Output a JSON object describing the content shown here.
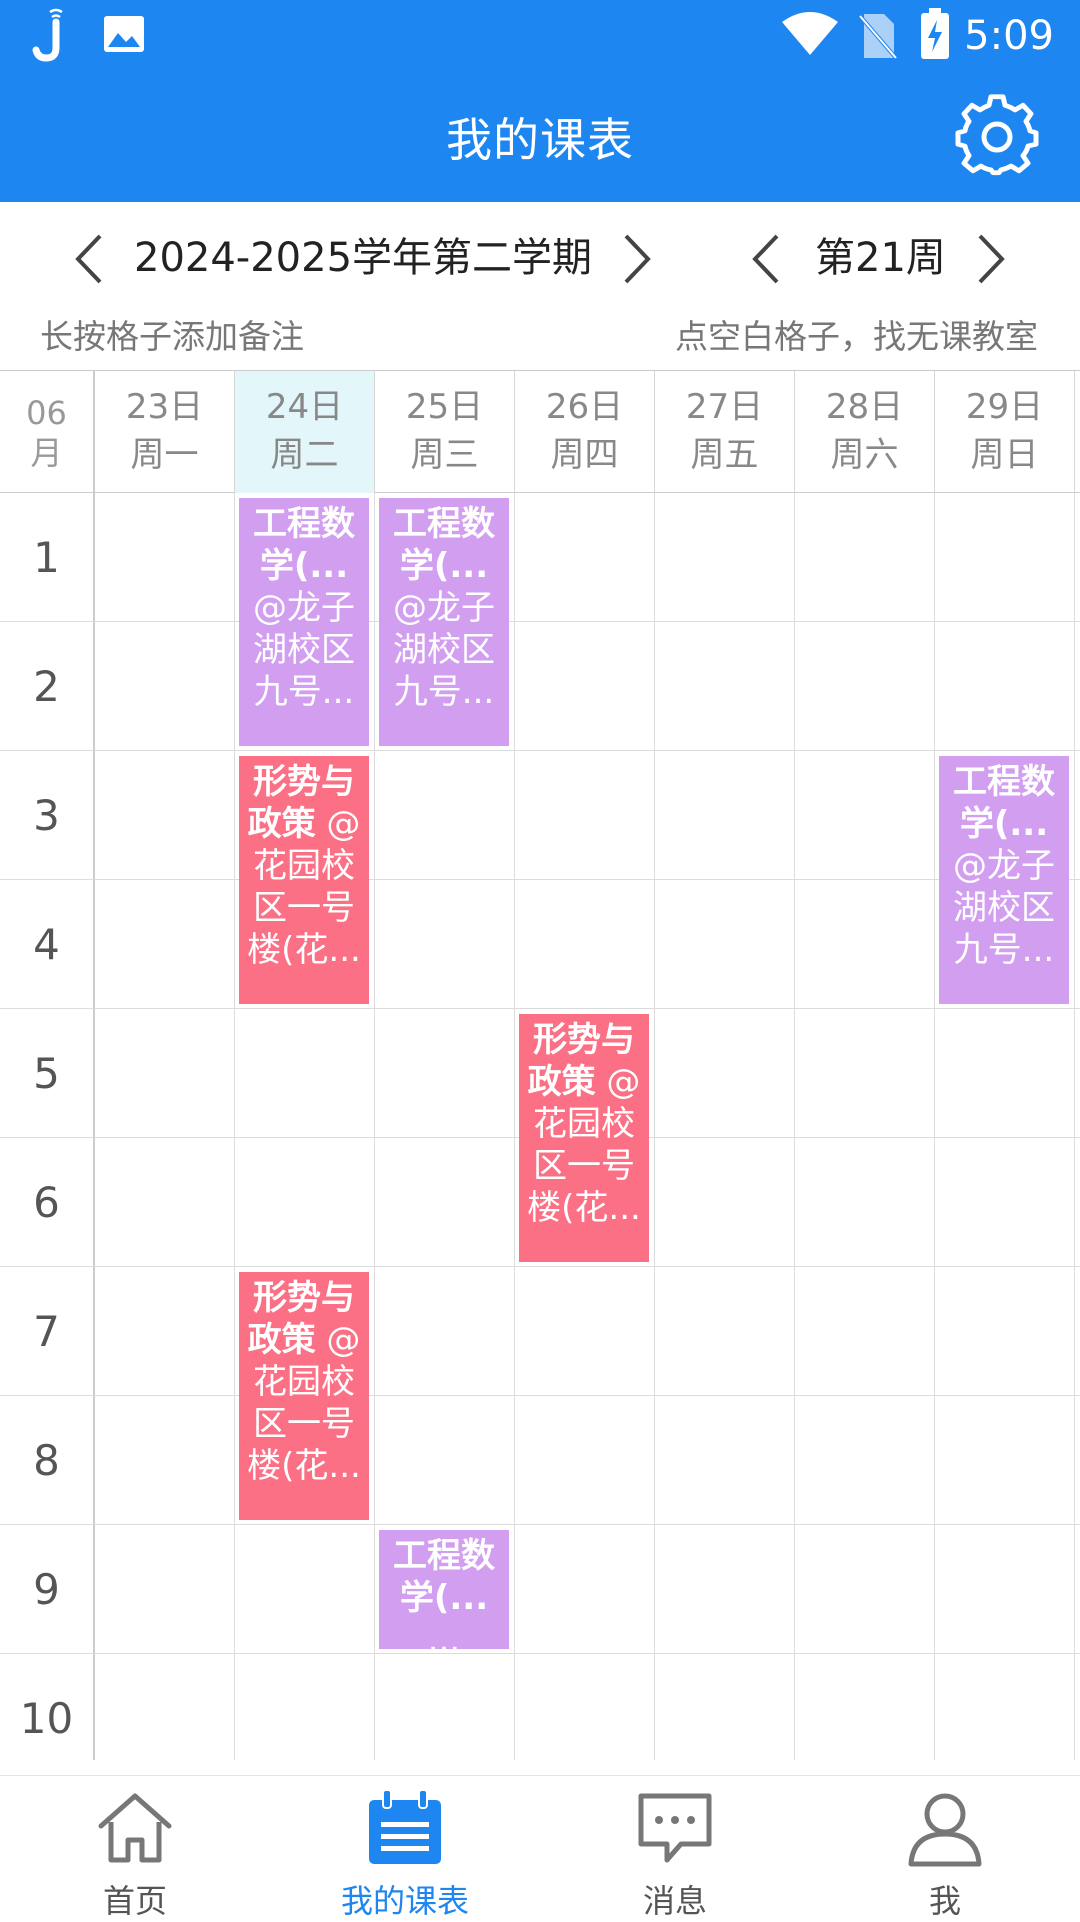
{
  "status_bar": {
    "time": "5:09",
    "icons": [
      "j-app-icon",
      "image-icon",
      "wifi-icon",
      "no-sim-icon",
      "battery-charging-icon"
    ]
  },
  "header": {
    "title": "我的课表",
    "settings_icon": "gear-icon"
  },
  "term_selector": {
    "term": "2024-2025学年第二学期",
    "week": "第21周"
  },
  "hints": {
    "left": "长按格子添加备注",
    "right": "点空白格子，找无课教室"
  },
  "schedule": {
    "month": "06\n月",
    "days": [
      {
        "date": "23日",
        "weekday": "周一"
      },
      {
        "date": "24日",
        "weekday": "周二"
      },
      {
        "date": "25日",
        "weekday": "周三"
      },
      {
        "date": "26日",
        "weekday": "周四"
      },
      {
        "date": "27日",
        "weekday": "周五"
      },
      {
        "date": "28日",
        "weekday": "周六"
      },
      {
        "date": "29日",
        "weekday": "周日"
      }
    ],
    "today_index": 1,
    "periods": [
      "1",
      "2",
      "3",
      "4",
      "5",
      "6",
      "7",
      "8",
      "9",
      "10"
    ],
    "courses": [
      {
        "day": 1,
        "start": 1,
        "span": 2,
        "color": "purple",
        "name": "工程数学(...",
        "location": "@龙子湖校区九号..."
      },
      {
        "day": 2,
        "start": 1,
        "span": 2,
        "color": "purple",
        "name": "工程数学(...",
        "location": "@龙子湖校区九号..."
      },
      {
        "day": 1,
        "start": 3,
        "span": 2,
        "color": "red",
        "name": "形势与政策",
        "location": "@花园校区一号楼(花..."
      },
      {
        "day": 6,
        "start": 3,
        "span": 2,
        "color": "purple",
        "name": "工程数学(...",
        "location": "@龙子湖校区九号..."
      },
      {
        "day": 3,
        "start": 5,
        "span": 2,
        "color": "red",
        "name": "形势与政策",
        "location": "@花园校区一号楼(花..."
      },
      {
        "day": 1,
        "start": 7,
        "span": 2,
        "color": "red",
        "name": "形势与政策",
        "location": "@花园校区一号楼(花..."
      },
      {
        "day": 2,
        "start": 9,
        "span": 1,
        "color": "purple",
        "name": "工程数学(...",
        "location": "..."
      }
    ]
  },
  "colors": {
    "primary": "#1e86f0",
    "purple_course": "#d29ef0",
    "red_course": "#fb7085",
    "today_bg": "#e3f7fb"
  },
  "bottom_nav": [
    {
      "label": "首页",
      "icon": "home-icon",
      "active": false
    },
    {
      "label": "我的课表",
      "icon": "calendar-icon",
      "active": true
    },
    {
      "label": "消息",
      "icon": "message-icon",
      "active": false
    },
    {
      "label": "我",
      "icon": "person-icon",
      "active": false
    }
  ]
}
